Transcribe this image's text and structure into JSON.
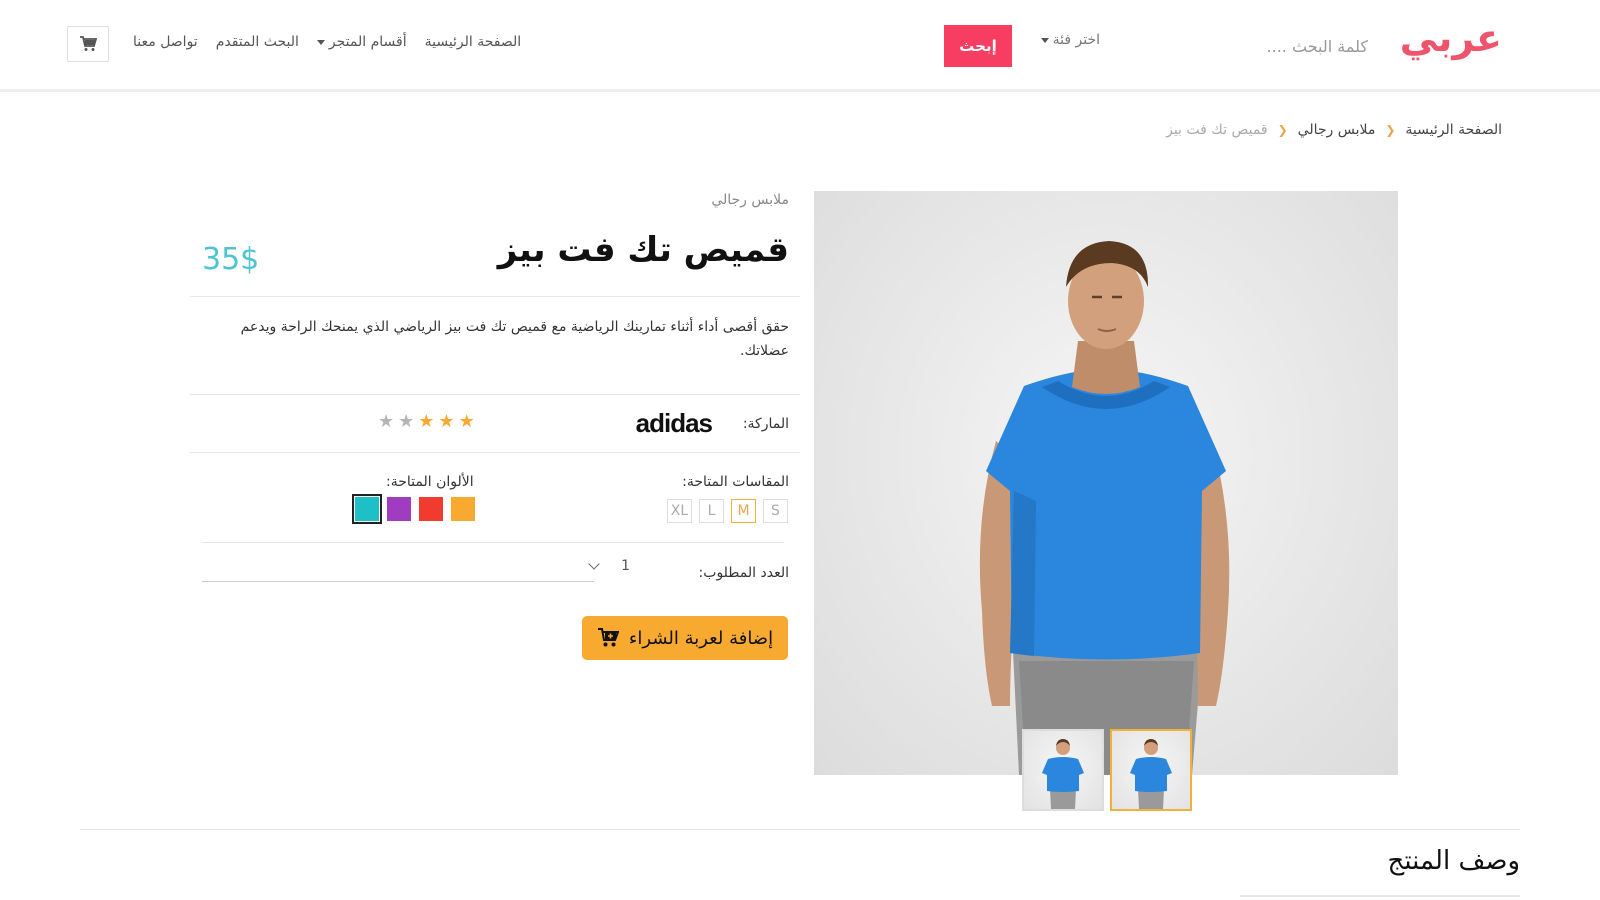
{
  "header": {
    "logo": "عربي",
    "search_placeholder": "كلمة البحث ....",
    "category_select": "اختر فئة",
    "search_button": "إبحث",
    "nav": [
      {
        "label": "الصفحة الرئيسية"
      },
      {
        "label": "أقسام المتجر"
      },
      {
        "label": "البحث المتقدم"
      },
      {
        "label": "تواصل معنا"
      }
    ]
  },
  "breadcrumb": {
    "home": "الصفحة الرئيسية",
    "category": "ملابس رجالي",
    "current": "قميص تك فت بيز"
  },
  "product": {
    "category": "ملابس رجالي",
    "title": "قميص تك فت بيز",
    "price": "35$",
    "description": "حقق أقصى أداء أثناء تمارينك الرياضية مع قميص تك فت بيز الرياضي الذي يمنحك الراحة ويدعم عضلاتك.",
    "brand_label": "الماركة:",
    "brand": "adidas",
    "rating": 3,
    "rating_max": 5,
    "sizes_label": "المقاسات المتاحة:",
    "sizes": [
      "S",
      "M",
      "L",
      "XL"
    ],
    "selected_size": "M",
    "colors_label": "الألوان المتاحة:",
    "colors": [
      "#f8a92f",
      "#f03b2e",
      "#a03cc0",
      "#1ec0c8"
    ],
    "selected_color": "#1ec0c8",
    "quantity_label": "العدد المطلوب:",
    "quantity": "1",
    "add_to_cart": "إضافة لعربة الشراء"
  },
  "section": {
    "title": "وصف المنتج"
  },
  "theme": {
    "accent": "#f73e62",
    "price_color": "#4fc3d0",
    "star_on": "#f8a92f",
    "star_off": "#b5b5b5",
    "button_color": "#f8a92f"
  },
  "icons": {
    "cart": "cart-icon",
    "add_cart": "cart-plus-icon",
    "chevron": "chevron-down-icon",
    "star": "star-icon"
  }
}
